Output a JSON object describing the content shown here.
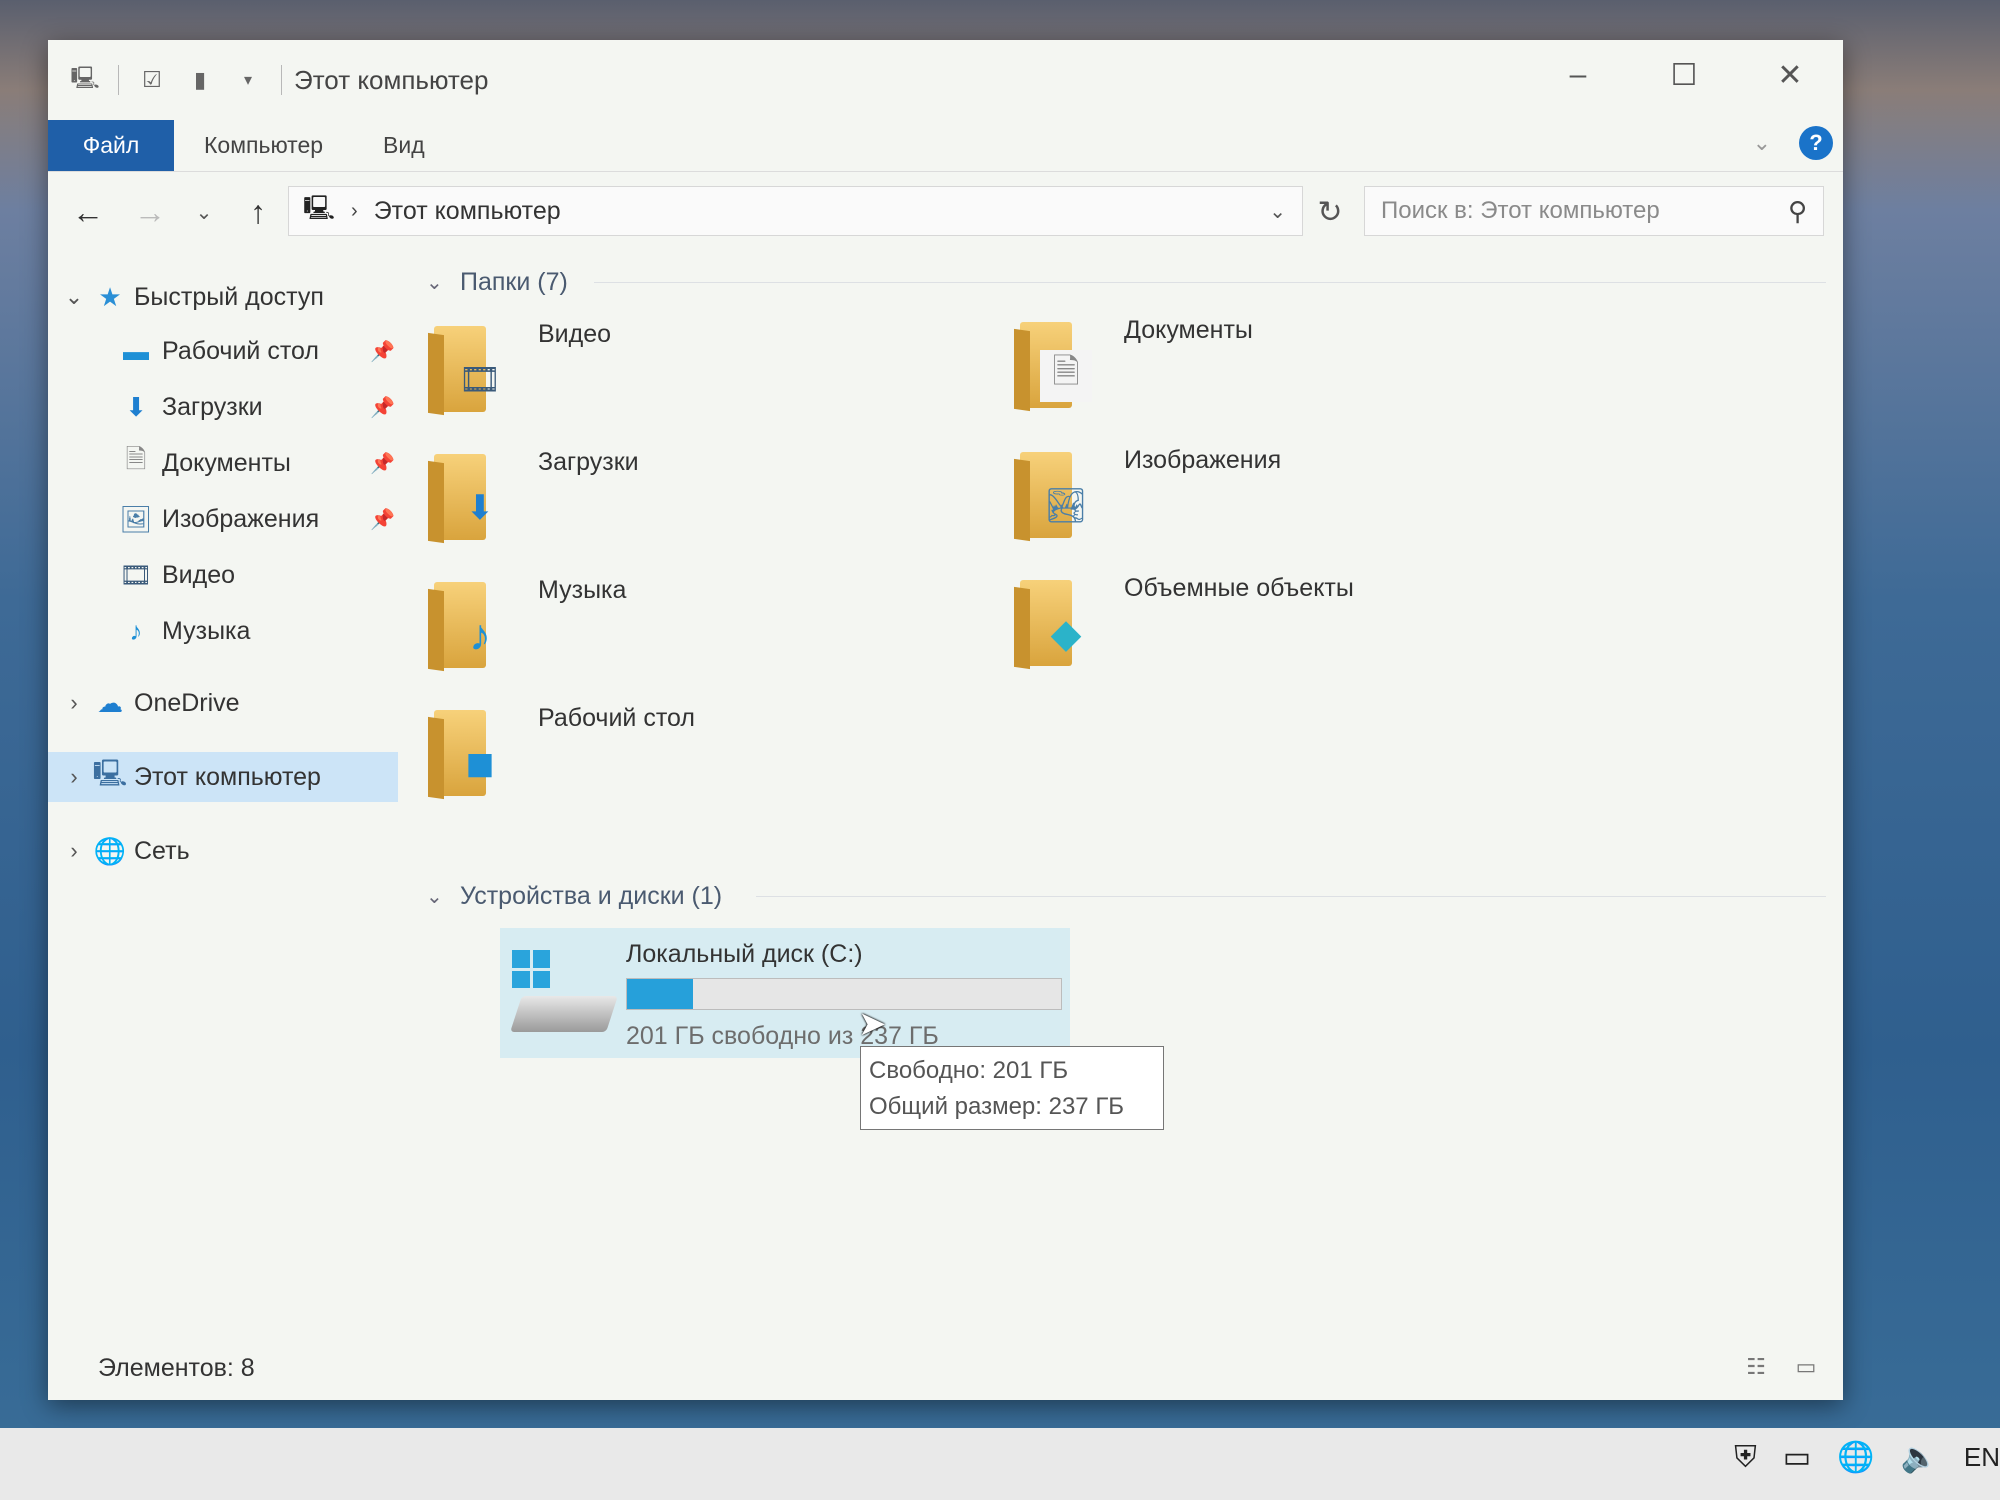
{
  "window": {
    "title": "Этот компьютер"
  },
  "title_bar": {
    "icons": [
      "computer-icon",
      "properties-check-icon",
      "new-folder-icon",
      "customize-qat-icon"
    ]
  },
  "window_controls": {
    "minimize": "–",
    "maximize": "☐",
    "close": "✕"
  },
  "ribbon": {
    "tabs": [
      {
        "label": "Файл",
        "active": true
      },
      {
        "label": "Компьютер"
      },
      {
        "label": "Вид"
      }
    ],
    "help": "?"
  },
  "address_bar": {
    "path": "Этот компьютер",
    "search_placeholder": "Поиск в: Этот компьютер"
  },
  "nav_pane": {
    "quick_access": "Быстрый доступ",
    "pinned": [
      {
        "label": "Рабочий стол",
        "icon": "desktop-icon"
      },
      {
        "label": "Загрузки",
        "icon": "download-icon"
      },
      {
        "label": "Документы",
        "icon": "document-icon"
      },
      {
        "label": "Изображения",
        "icon": "image-icon"
      }
    ],
    "recent": [
      {
        "label": "Видео",
        "icon": "video-icon"
      },
      {
        "label": "Музыка",
        "icon": "music-icon"
      }
    ],
    "onedrive": "OneDrive",
    "this_pc": "Этот компьютер",
    "network": "Сеть"
  },
  "content": {
    "folders_header": "Папки (7)",
    "folders": [
      {
        "label": "Видео",
        "badge": "video-icon"
      },
      {
        "label": "Документы",
        "badge": "document-icon"
      },
      {
        "label": "Загрузки",
        "badge": "download-icon"
      },
      {
        "label": "Изображения",
        "badge": "image-icon"
      },
      {
        "label": "Музыка",
        "badge": "music-icon"
      },
      {
        "label": "Объемные объекты",
        "badge": "3d-objects-icon"
      },
      {
        "label": "Рабочий стол",
        "badge": "desktop-icon"
      }
    ],
    "devices_header": "Устройства и диски (1)",
    "drive": {
      "name": "Локальный диск (C:)",
      "free_text": "201 ГБ свободно из 237 ГБ",
      "used_fraction": 0.152,
      "bar_color": "#26a0da"
    },
    "tooltip": {
      "free": "Свободно: 201 ГБ",
      "total": "Общий размер: 237 ГБ"
    }
  },
  "status_bar": {
    "count": "Элементов: 8"
  },
  "taskbar": {
    "language": "EN",
    "tray_icons": [
      "security-shield-icon",
      "battery-icon",
      "network-globe-icon",
      "volume-icon"
    ]
  },
  "colors": {
    "accent": "#1f5fa8",
    "selection": "#cce4f7",
    "drive_highlight": "#d7ecf2"
  }
}
